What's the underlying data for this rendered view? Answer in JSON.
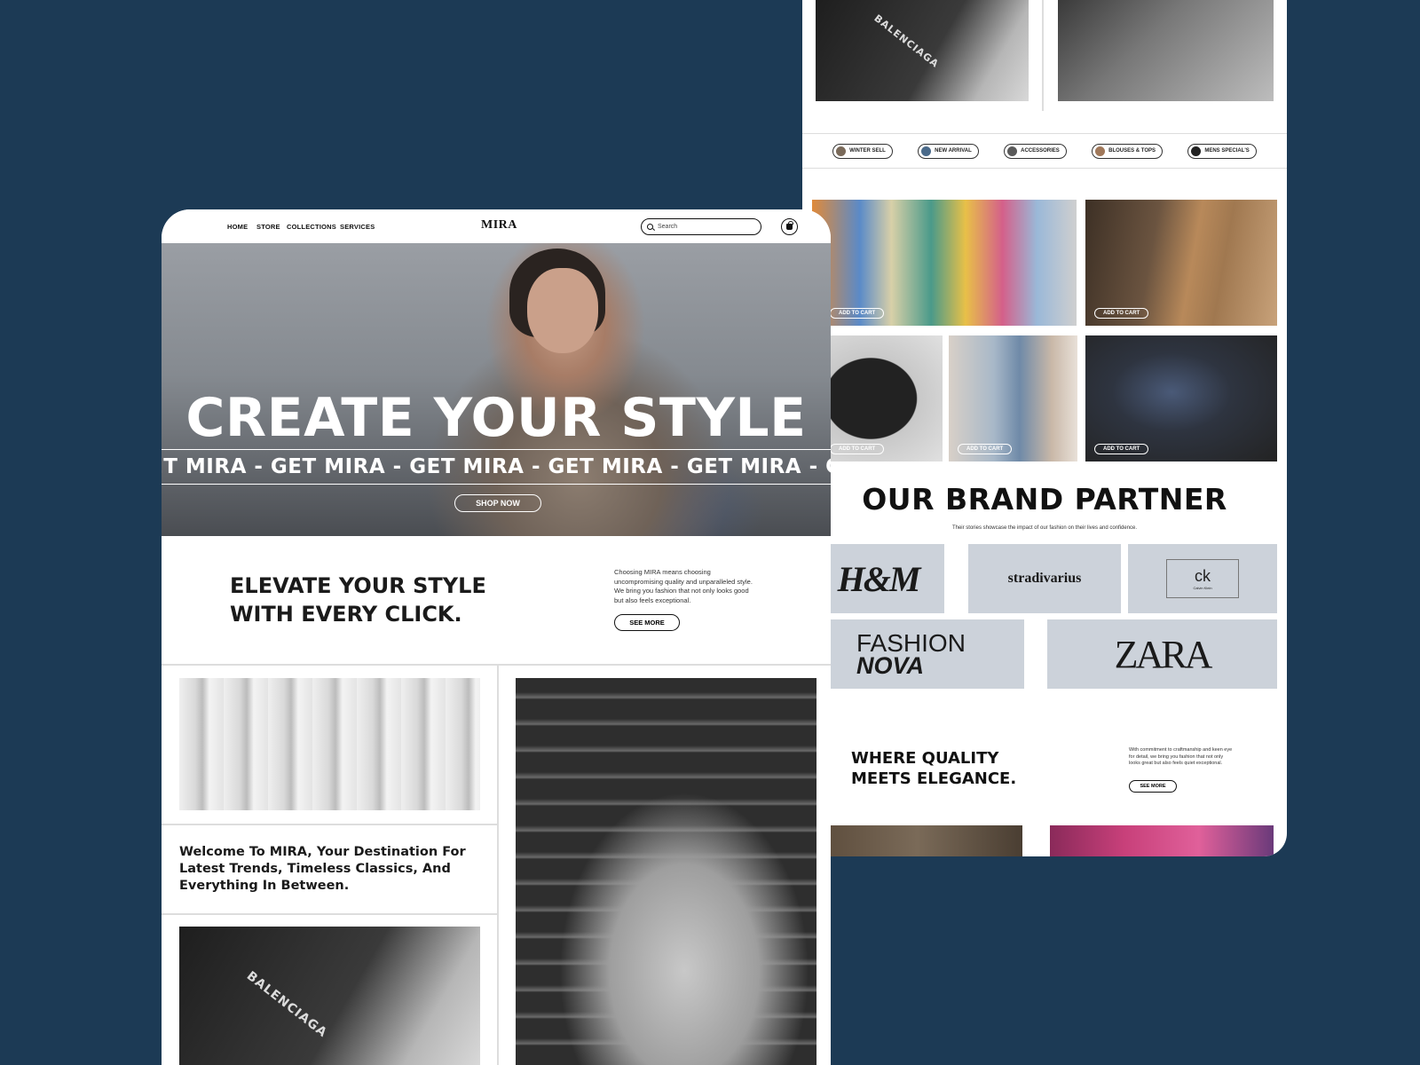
{
  "nav": {
    "links": [
      "HOME",
      "STORE",
      "COLLECTIONS",
      "SERVICES"
    ],
    "logo": "MIRA",
    "search_placeholder": "Search",
    "cart_icon": "shopping-bag-icon",
    "search_icon": "search-icon"
  },
  "hero": {
    "title": "CREATE YOUR STYLE",
    "marquee": "ET MIRA - GET MIRA - GET MIRA - GET MIRA - GET MIRA - GE",
    "cta": "SHOP NOW"
  },
  "intro": {
    "title_line1": "ELEVATE YOUR STYLE",
    "title_line2": "WITH EVERY CLICK.",
    "text": "Choosing MIRA means choosing uncompromising quality and unparalleled style. We bring you fashion that not only looks good but also feels exceptional.",
    "cta": "SEE MORE"
  },
  "welcome": {
    "text": "Welcome To MIRA, Your Destination For Latest Trends, Timeless Classics, And Everything In Between."
  },
  "shirt_logo": "BALENCIAGA",
  "categories": [
    "WINTER SELL",
    "NEW ARRIVAL",
    "ACCESSORIES",
    "BLOUSES & TOPS",
    "MENS SPECIAL'S"
  ],
  "products": {
    "add_to_cart": "ADD TO CART"
  },
  "brands": {
    "title": "OUR BRAND PARTNER",
    "subtitle": "Their stories showcase the impact of our fashion on their lives and confidence.",
    "hm": "H&M",
    "stradivarius": "stradivarius",
    "ck": "ck",
    "ck_small": "Calvin Klein",
    "nova_line1": "FASHION",
    "nova_line2": "NOVA",
    "zara": "ZARA"
  },
  "quality": {
    "title_line1": "WHERE QUALITY",
    "title_line2": "MEETS ELEGANCE.",
    "text": "With commitment to craftmanship and keen eye for detail, we bring you fashion that not only looks great but also feels quiet exceptional.",
    "cta": "SEE MORE"
  },
  "colors": {
    "background": "#1c3a55",
    "panel": "#ffffff",
    "brand_tile": "#ccd2da",
    "text": "#111111"
  }
}
